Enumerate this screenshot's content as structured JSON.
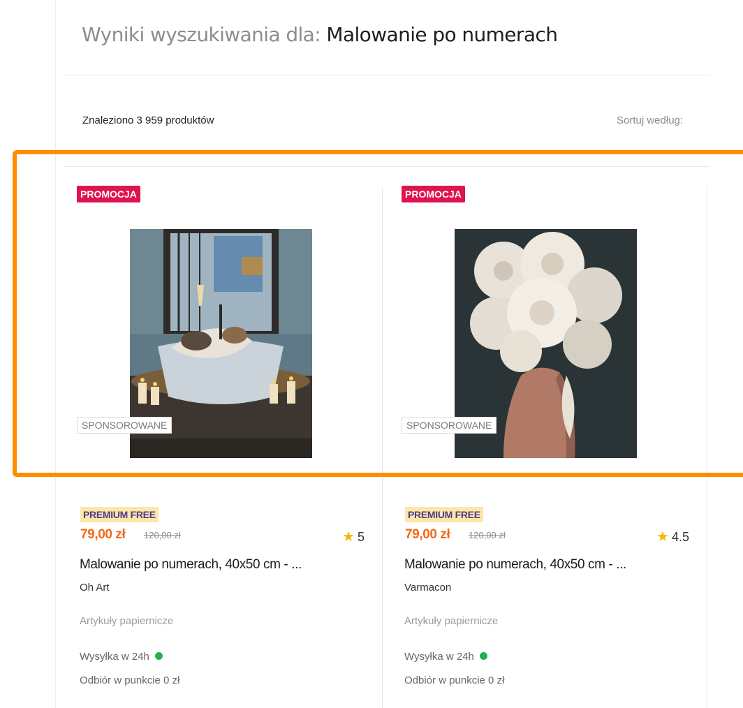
{
  "search": {
    "prefix": "Wyniki wyszukiwania dla:",
    "query": "Malowanie po numerach"
  },
  "results": {
    "count_text": "Znaleziono 3 959 produktów",
    "sort_label": "Sortuj według:"
  },
  "products": [
    {
      "promo_badge": "PROMOCJA",
      "sponsored": "SPONSOROWANE",
      "premium": "PREMIUM FREE",
      "price": "79,00 zł",
      "old_price": "120,00 zł",
      "rating": "5",
      "title": "Malowanie po numerach, 40x50 cm - ...",
      "seller": "Oh Art",
      "category": "Artykuły papiernicze",
      "delivery": "Wysyłka w 24h",
      "pickup": "Odbiór w punkcie 0 zł",
      "image_icon": "painting-cat-in-bathtub"
    },
    {
      "promo_badge": "PROMOCJA",
      "sponsored": "SPONSOROWANE",
      "premium": "PREMIUM FREE",
      "price": "79,00 zł",
      "old_price": "120,00 zł",
      "rating": "4.5",
      "title": "Malowanie po numerach, 40x50 cm - ...",
      "seller": "Varmacon",
      "category": "Artykuły papiernicze",
      "delivery": "Wysyłka w 24h",
      "pickup": "Odbiór w punkcie 0 zł",
      "image_icon": "painting-woman-with-peony-flowers"
    }
  ],
  "colors": {
    "promo": "#e0134e",
    "price": "#f26a18",
    "premium_bg": "#fde7a8",
    "premium_text": "#4a3c8c",
    "star": "#f5b800",
    "delivery_dot": "#22b14c",
    "highlight": "#ff8c00"
  }
}
